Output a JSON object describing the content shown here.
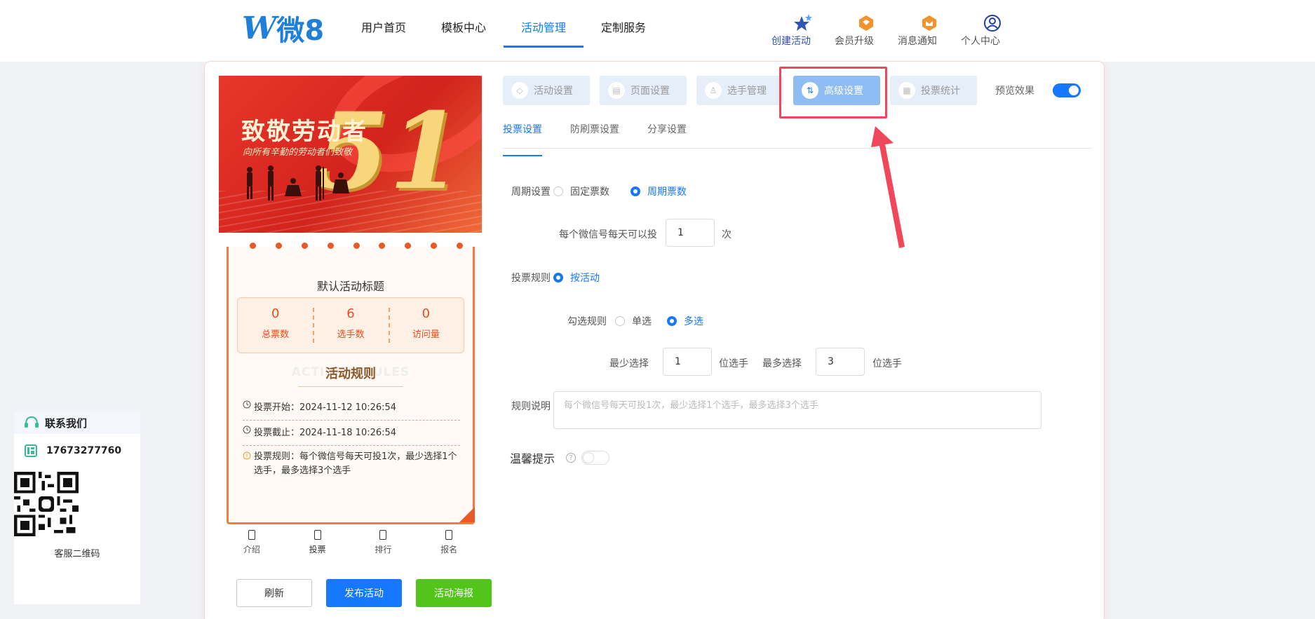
{
  "logo": {
    "mark": "W",
    "text": "微8"
  },
  "nav": [
    "用户首页",
    "模板中心",
    "活动管理",
    "定制服务"
  ],
  "tools": [
    {
      "label": "创建活动",
      "icon": "stars-icon"
    },
    {
      "label": "会员升级",
      "icon": "diamond-icon"
    },
    {
      "label": "消息通知",
      "icon": "bell-icon"
    },
    {
      "label": "个人中心",
      "icon": "user-icon"
    }
  ],
  "banner": {
    "title": "致敬劳动者",
    "subtitle": "向所有辛勤的劳动者们致敬",
    "number": "51"
  },
  "activity": {
    "title": "默认活动标题",
    "stats": [
      {
        "value": "0",
        "label": "总票数"
      },
      {
        "value": "6",
        "label": "选手数"
      },
      {
        "value": "0",
        "label": "访问量"
      }
    ],
    "rules_bg": "ACTIVITY RULES",
    "rules_title": "活动规则",
    "start": "投票开始：2024-11-12 10:26:54",
    "end": "投票截止：2024-11-18 10:26:54",
    "rule": "投票规则：每个微信号每天可投1次，最少选择1个选手，最多选择3个选手"
  },
  "tabbar": [
    "介绍",
    "投票",
    "排行",
    "报名"
  ],
  "buttons": {
    "refresh": "刷新",
    "publish": "发布活动",
    "poster": "活动海报"
  },
  "steps": [
    "活动设置",
    "页面设置",
    "选手管理",
    "高级设置",
    "投票统计"
  ],
  "preview_label": "预览效果",
  "subtabs": [
    "投票设置",
    "防刷票设置",
    "分享设置"
  ],
  "form": {
    "cycle_label": "周期设置",
    "cycle_fixed": "固定票数",
    "cycle_periodic": "周期票数",
    "daily_label": "每个微信号每天可以投",
    "daily_value": "1",
    "daily_unit": "次",
    "rule_label": "投票规则",
    "rule_by": "按活动",
    "check_label": "勾选规则",
    "single": "单选",
    "multi": "多选",
    "min_label": "最少选择",
    "min_value": "1",
    "min_unit": "位选手",
    "max_label": "最多选择",
    "max_value": "3",
    "max_unit": "位选手",
    "desc_label": "规则说明",
    "desc_placeholder": "每个微信号每天可投1次，最少选择1个选手，最多选择3个选手",
    "tip_label": "温馨提示"
  },
  "contact": {
    "title": "联系我们",
    "phone": "17673277760",
    "qr_label": "客服二维码"
  },
  "colors": {
    "primary": "#1677ff",
    "accent": "#e84d1c",
    "highlight": "#f0475a"
  }
}
